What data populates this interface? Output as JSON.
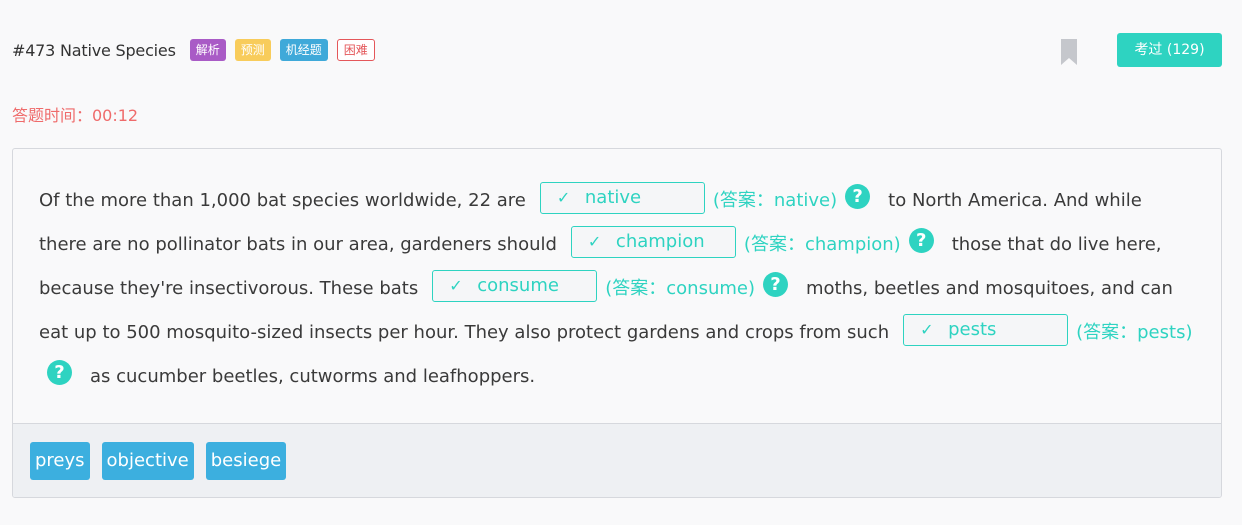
{
  "header": {
    "title": "#473 Native Species",
    "tags": [
      "解析",
      "预测",
      "机经题",
      "困难"
    ],
    "exam_button": "考过 (129)"
  },
  "timer": "答题时间：00:12",
  "passage": {
    "seg1": "Of the more than 1,000 bat species worldwide, 22 are",
    "seg2": "to North America. And while there are no pollinator bats in our area, gardeners should",
    "seg3": "those that do live here, because they're insectivorous. These bats",
    "seg4": "moths, beetles and mosquitoes, and can eat up to 500 mosquito-sized insects per hour. They also protect gardens and crops from such",
    "seg5": "as cucumber beetles, cutworms and leafhoppers."
  },
  "blanks": [
    {
      "value": "native",
      "answer": "(答案：native)"
    },
    {
      "value": "champion",
      "answer": "(答案：champion)"
    },
    {
      "value": "consume",
      "answer": "(答案：consume)"
    },
    {
      "value": "pests",
      "answer": "(答案：pests)"
    }
  ],
  "check_glyph": "✓",
  "help_glyph": "?",
  "options": [
    "preys",
    "objective",
    "besiege"
  ],
  "colors": {
    "accent": "#2ed3c1",
    "timer": "#ef6b6b",
    "option": "#3cafdf",
    "tag_purple": "#a95bc6",
    "tag_yellow": "#f8cc5b",
    "tag_blue": "#3fa9d9",
    "tag_outline": "#e4575a"
  }
}
